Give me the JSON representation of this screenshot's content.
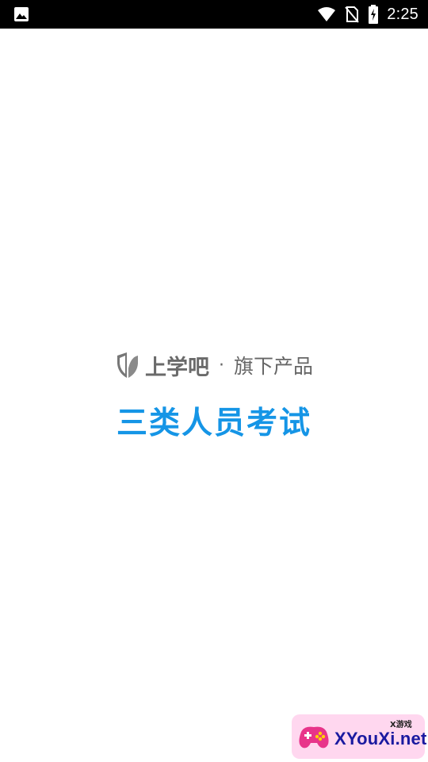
{
  "status_bar": {
    "time": "2:25",
    "left_icon": "image-icon",
    "icons": [
      "wifi-icon",
      "no-sim-icon",
      "battery-charging-icon"
    ]
  },
  "brand": {
    "name": "上学吧",
    "separator": "·",
    "suffix": "旗下产品",
    "logo_icon": "leaf-shield-logo-icon"
  },
  "app": {
    "title": "三类人员考试",
    "title_color": "#1595e6"
  },
  "watermark": {
    "small_text": "X游戏",
    "text": "XYouXi.net",
    "icon": "gamepad-icon"
  }
}
